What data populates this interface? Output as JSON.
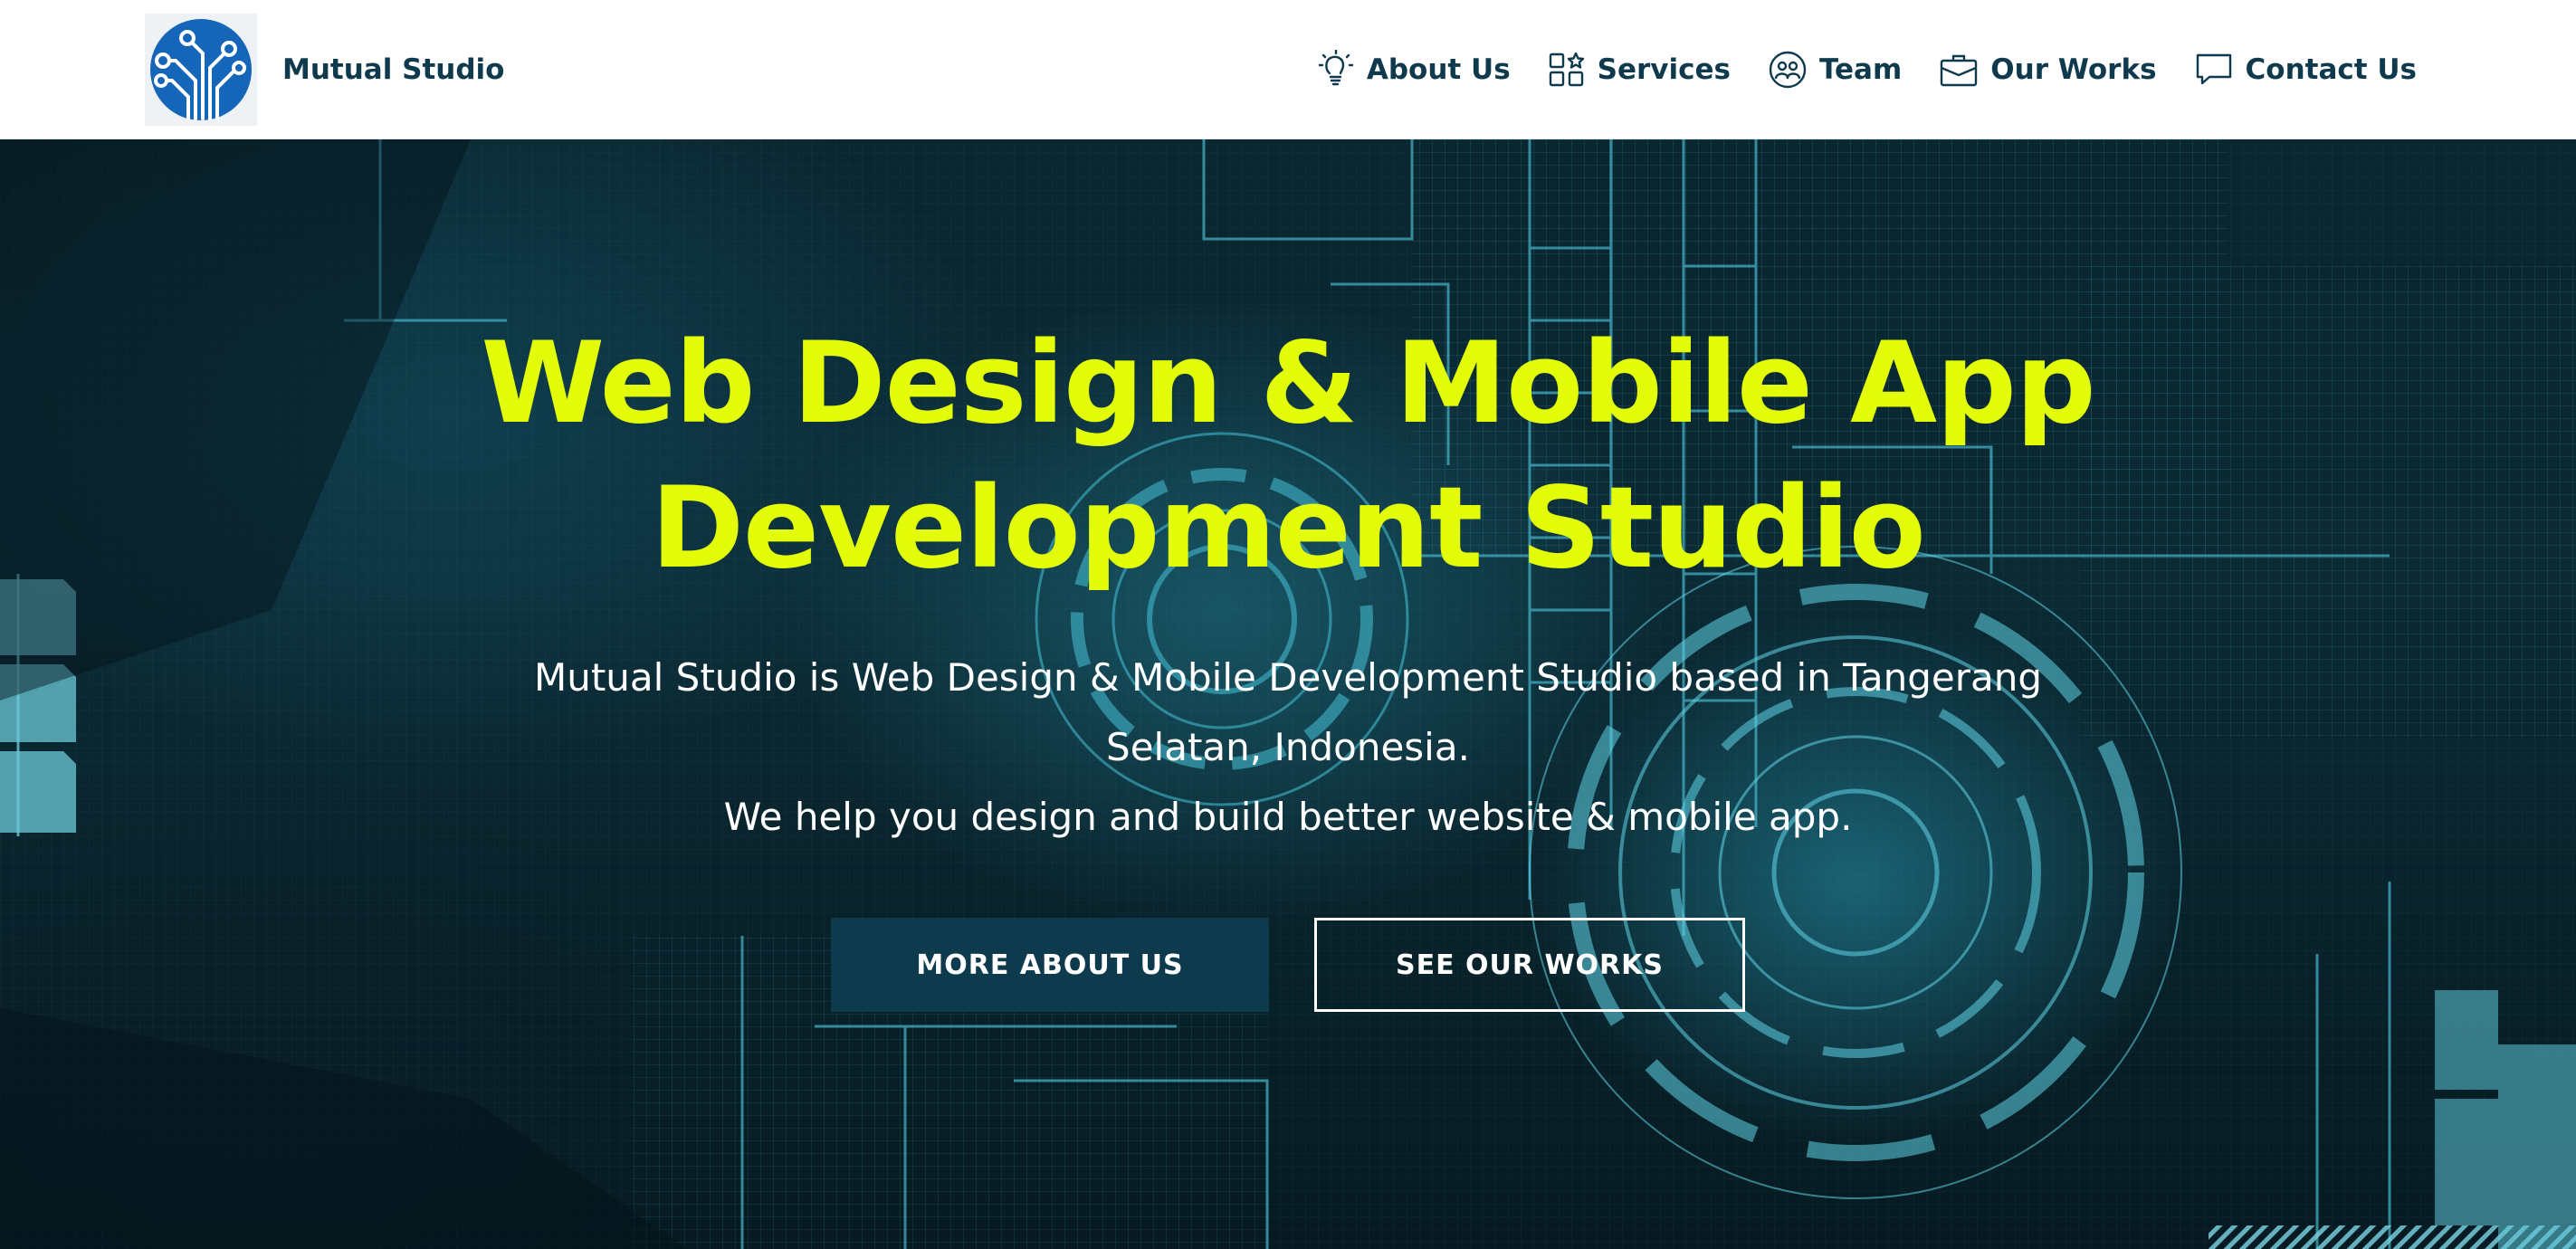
{
  "brand": {
    "name": "Mutual Studio",
    "logo_icon": "circuit-logo-icon"
  },
  "nav": {
    "items": [
      {
        "label": "About Us",
        "icon": "lightbulb-icon"
      },
      {
        "label": "Services",
        "icon": "grid-star-icon"
      },
      {
        "label": "Team",
        "icon": "team-icon"
      },
      {
        "label": "Our Works",
        "icon": "briefcase-icon"
      },
      {
        "label": "Contact Us",
        "icon": "chat-icon"
      }
    ]
  },
  "hero": {
    "title_line1": "Web Design & Mobile App",
    "title_line2": "Development Studio",
    "desc_line1": "Mutual Studio is Web Design & Mobile Development Studio based in Tangerang",
    "desc_line2": "Selatan, Indonesia.",
    "desc_line3": "We help you design and build better website & mobile app.",
    "primary_button": "MORE ABOUT US",
    "secondary_button": "SEE OUR WORKS"
  },
  "colors": {
    "navy": "#0f3a4d",
    "accent": "#e2fc0a",
    "logo_blue": "#1565b8",
    "button_bg": "#0e3a4e"
  }
}
